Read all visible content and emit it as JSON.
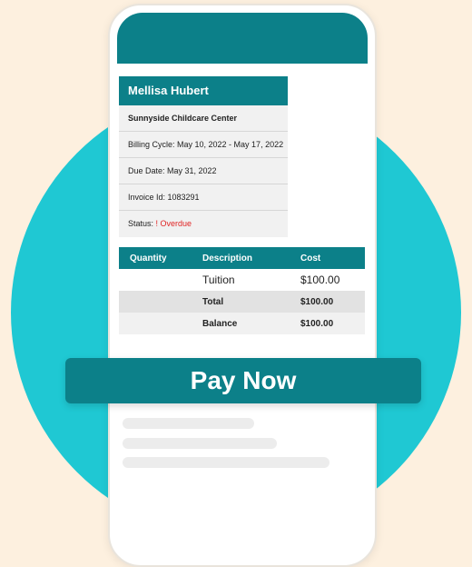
{
  "invoice": {
    "customer_name": "Mellisa Hubert",
    "center_name": "Sunnyside Childcare Center",
    "billing_cycle": "Billing Cycle: May 10, 2022 - May 17, 2022",
    "due_date": "Due Date: May 31, 2022",
    "invoice_id": "Invoice Id: 1083291",
    "status_label": "Status: ",
    "status_value": "! Overdue",
    "status_color": "#e02424"
  },
  "table": {
    "headers": [
      "Quantity",
      "Description",
      "Cost"
    ],
    "rows": [
      {
        "quantity": "",
        "description": "Tuition",
        "cost": "$100.00"
      },
      {
        "quantity": "",
        "description": "Total",
        "cost": "$100.00"
      },
      {
        "quantity": "",
        "description": "Balance",
        "cost": "$100.00"
      }
    ]
  },
  "pay_button": {
    "label": "Pay Now"
  },
  "colors": {
    "accent": "#0c8089",
    "circle": "#1fc8d3",
    "background": "#fdf0df"
  }
}
